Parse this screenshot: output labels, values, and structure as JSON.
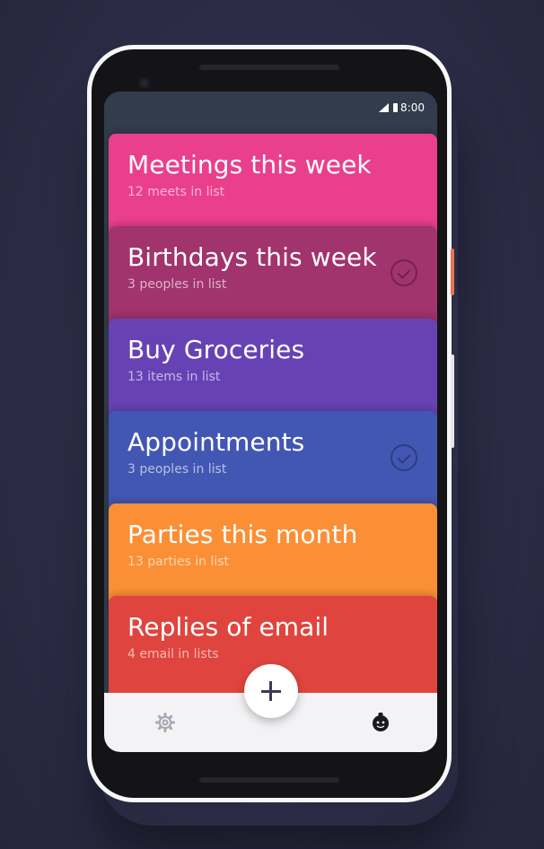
{
  "status_bar": {
    "time": "8:00",
    "icons": [
      "signal-icon",
      "battery-icon"
    ]
  },
  "lists": [
    {
      "title": "Meetings this week",
      "subtitle": "12 meets in list",
      "color": "#ea3f8d",
      "checked": false
    },
    {
      "title": "Birthdays this week",
      "subtitle": "3 peoples in list",
      "color": "#a1336d",
      "checked": true
    },
    {
      "title": "Buy Groceries",
      "subtitle": "13 items in list",
      "color": "#6742b5",
      "checked": false
    },
    {
      "title": "Appointments",
      "subtitle": "3 peoples in list",
      "color": "#4256b3",
      "checked": true
    },
    {
      "title": "Parties this month",
      "subtitle": "13 parties in list",
      "color": "#fb8f35",
      "checked": false
    },
    {
      "title": "Replies of email",
      "subtitle": "4 email in lists",
      "color": "#e0443e",
      "checked": false
    }
  ],
  "bottom_bar": {
    "left_icon": "gear-icon",
    "fab_icon": "plus-icon",
    "right_icon": "avatar"
  },
  "colors": {
    "background": "#2c2c47",
    "status_bar": "#323c4c",
    "bottom_bar": "#f3f3f5",
    "phone_frame": "#f7f7f8"
  }
}
